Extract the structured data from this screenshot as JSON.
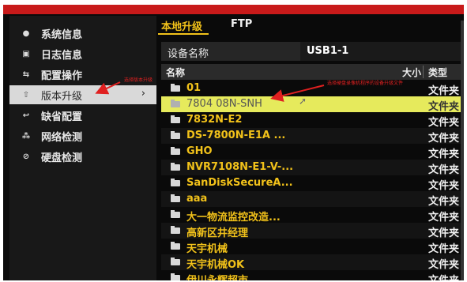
{
  "sidebar": {
    "items": [
      {
        "label": "系统信息",
        "icon": "info-icon",
        "glyph": "●"
      },
      {
        "label": "日志信息",
        "icon": "log-icon",
        "glyph": "▣"
      },
      {
        "label": "配置操作",
        "icon": "config-icon",
        "glyph": "⇆"
      },
      {
        "label": "版本升级",
        "icon": "upgrade-icon",
        "glyph": "⇧",
        "active": true,
        "chevron": "›"
      },
      {
        "label": "缺省配置",
        "icon": "default-config-icon",
        "glyph": "↩"
      },
      {
        "label": "网络检测",
        "icon": "network-icon",
        "glyph": "⁂"
      },
      {
        "label": "硬盘检测",
        "icon": "disk-icon",
        "glyph": "⊘"
      }
    ]
  },
  "tabs": {
    "local": "本地升级",
    "ftp": "FTP"
  },
  "device": {
    "label": "设备名称",
    "value": "USB1-1"
  },
  "file_table": {
    "headers": {
      "name": "名称",
      "size": "大小",
      "type": "类型"
    },
    "rows": [
      {
        "name": "01",
        "type": "文件夹"
      },
      {
        "name": "7804 08N-SNH",
        "type": "文件夹",
        "selected": true
      },
      {
        "name": "7832N-E2",
        "type": "文件夹"
      },
      {
        "name": "DS-7800N-E1A ...",
        "type": "文件夹"
      },
      {
        "name": "GHO",
        "type": "文件夹"
      },
      {
        "name": "NVR7108N-E1-V-...",
        "type": "文件夹"
      },
      {
        "name": "SanDiskSecureA...",
        "type": "文件夹"
      },
      {
        "name": "aaa",
        "type": "文件夹"
      },
      {
        "name": "大一物流监控改造...",
        "type": "文件夹"
      },
      {
        "name": "高新区井经理",
        "type": "文件夹"
      },
      {
        "name": "天宇机械",
        "type": "文件夹"
      },
      {
        "name": "天宇机械OK",
        "type": "文件夹"
      },
      {
        "name": "伊川永辉超市",
        "type": "文件夹"
      }
    ]
  },
  "annotations": {
    "left_caption": "选择版本升级",
    "right_caption": "选择硬盘录像机程序的设备升级文件"
  },
  "colors": {
    "accent_yellow": "#f2c21a",
    "selected_row": "#e6ea5c",
    "annotation_red": "#e02020",
    "top_strip": "#c81a1a"
  }
}
